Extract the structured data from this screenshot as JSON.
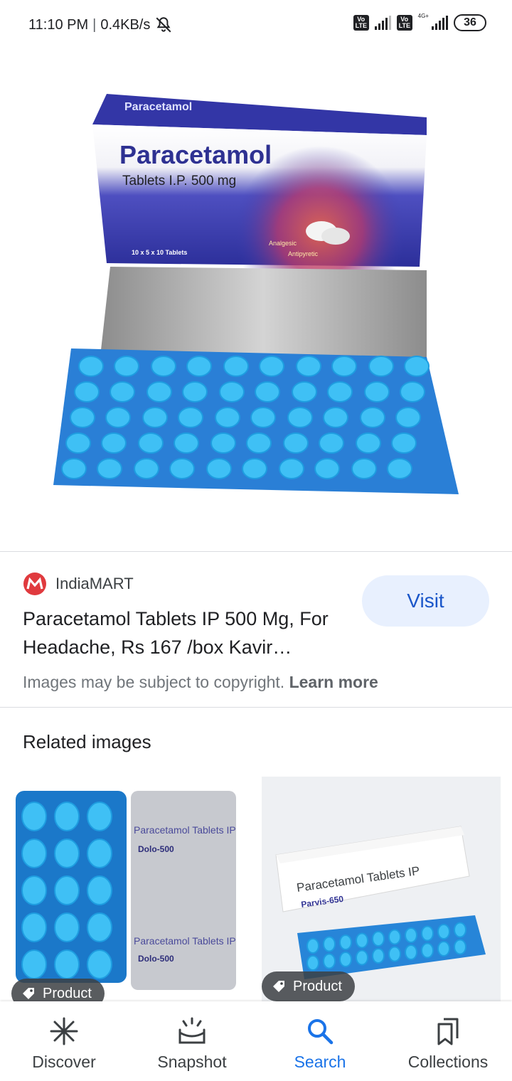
{
  "status_bar": {
    "time": "11:10 PM",
    "speed": "0.4KB/s",
    "sim1": "Vo\nLTE",
    "sim2": "Vo\nLTE",
    "network": "4G+",
    "battery": "36"
  },
  "result": {
    "site_name": "IndiaMART",
    "title": "Paracetamol Tablets IP 500 Mg, For Headache, Rs 167 /box Kavir…",
    "visit_label": "Visit",
    "copyright_text": "Images may be subject to copyright.",
    "learn_more": "Learn more"
  },
  "hero_image": {
    "brand": "Paracetamol",
    "strength": "Tablets I.P. 500 mg",
    "pack": "10 x 5 x 10 Tablets",
    "claim1": "Analgesic",
    "claim2": "Antipyretic"
  },
  "related": {
    "heading": "Related images",
    "items": [
      {
        "chip": "Product",
        "text1": "Paracetamol Tablets IP",
        "text2": "Dolo-500"
      },
      {
        "chip": "Product",
        "text1": "Paracetamol Tablets IP",
        "text2": "Parvis-650"
      }
    ]
  },
  "bottom_nav": {
    "items": [
      {
        "label": "Discover",
        "icon": "asterisk-icon"
      },
      {
        "label": "Snapshot",
        "icon": "snapshot-icon"
      },
      {
        "label": "Search",
        "icon": "search-icon"
      },
      {
        "label": "Collections",
        "icon": "bookmarks-icon"
      }
    ],
    "active": "Search"
  },
  "colors": {
    "accent": "#1a73e8",
    "visit_bg": "#e8f0fe",
    "pill_blue": "#1e9de0"
  }
}
